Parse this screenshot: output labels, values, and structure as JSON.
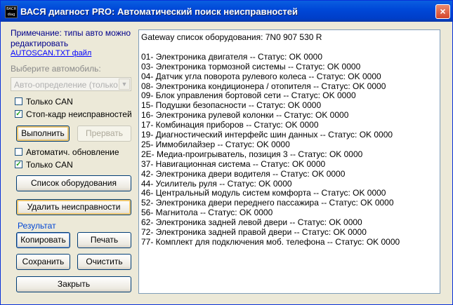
{
  "window": {
    "app_icon_text": "ВАСЯ diag",
    "title": "ВАСЯ диагност PRO:  Автоматический поиск неисправностей",
    "close_label": "×"
  },
  "left_panel": {
    "note": "Примечание: типы авто можно редактировать",
    "note_link": "AUTOSCAN.TXT файл",
    "select_label": "Выберите автомобиль:",
    "select_value": "Авто-определение (только",
    "checkbox_only_can_1": {
      "label": "Только CAN",
      "checked": false
    },
    "checkbox_freeze_frame": {
      "label": "Стоп-кадр неисправностей",
      "checked": true
    },
    "execute_button": "Выполнить",
    "abort_button": "Прервать",
    "checkbox_auto_update": {
      "label": "Автоматич. обновление",
      "checked": false
    },
    "checkbox_only_can_2": {
      "label": "Только CAN",
      "checked": true
    },
    "equipment_list_button": "Список оборудования",
    "clear_faults_button": "Удалить неисправности",
    "result_label": "Результат",
    "copy_button": "Копировать",
    "print_button": "Печать",
    "save_button": "Сохранить",
    "clear_button": "Очистить",
    "close_button": "Закрыть"
  },
  "output": {
    "lines": [
      "Gateway список оборудования:  7N0 907 530 R",
      "",
      "01- Электроника двигателя -- Статус: OK 0000",
      "03- Электроника тормозной системы -- Статус: OK 0000",
      "04- Датчик угла поворота рулевого колеса -- Статус: OK 0000",
      "08- Электроника кондиционера / отопителя -- Статус: OK 0000",
      "09- Блок управления бортовой сети -- Статус: OK 0000",
      "15- Подушки безопасности -- Статус: OK 0000",
      "16- Электроника рулевой колонки -- Статус: OK 0000",
      "17- Комбинация приборов -- Статус: OK 0000",
      "19- Диагностический интерфейс шин данных -- Статус: OK 0000",
      "25- Иммобилайзер -- Статус: OK 0000",
      "2E- Медиа-проигрыватель, позиция 3 -- Статус: OK 0000",
      "37- Навигационная система -- Статус: OK 0000",
      "42- Электроника двери водителя -- Статус: OK 0000",
      "44- Усилитель руля -- Статус: OK 0000",
      "46- Центральный модуль систем комфорта -- Статус: OK 0000",
      "52- Электроника двери переднего пассажира -- Статус: OK 0000",
      "56- Магнитола -- Статус: OK 0000",
      "62- Электроника задней левой двери -- Статус: OK 0000",
      "72- Электроника задней правой двери -- Статус: OK 0000",
      "77- Комплект для подключения моб. телефона -- Статус: OK 0000"
    ]
  }
}
